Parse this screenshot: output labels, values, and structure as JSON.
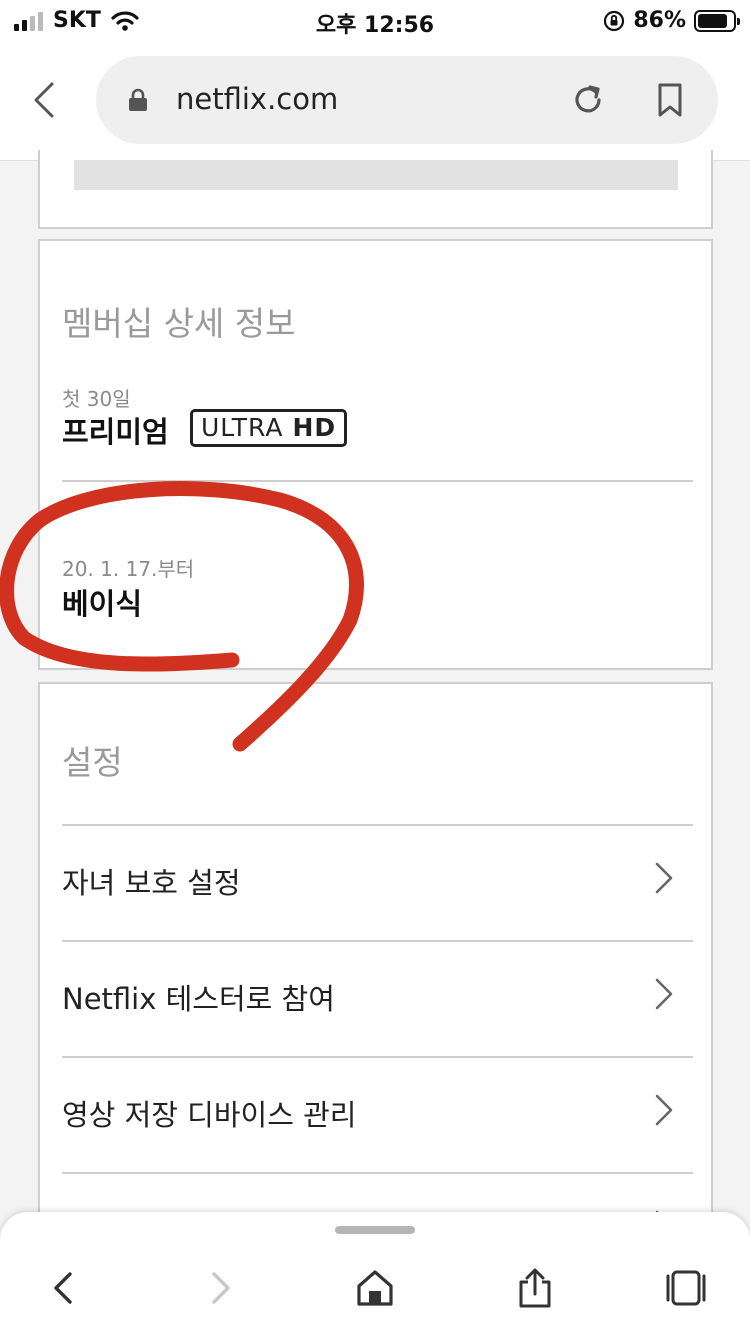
{
  "status_bar": {
    "carrier": "SKT",
    "time": "오후 12:56",
    "battery_percent": "86%",
    "battery_level": 0.86
  },
  "browser": {
    "url": "netflix.com"
  },
  "membership": {
    "title": "멤버십 상세 정보",
    "current_plan": {
      "note": "첫 30일",
      "name": "프리미엄",
      "badge_regular": "ULTRA",
      "badge_bold": "HD"
    },
    "next_plan": {
      "note": "20. 1. 17.부터",
      "name": "베이식"
    }
  },
  "settings": {
    "title": "설정",
    "items": [
      {
        "label": "자녀 보호 설정"
      },
      {
        "label": "Netflix 테스터로 참여"
      },
      {
        "label": "영상 저장 디바이스 관리"
      },
      {
        "label": ""
      }
    ]
  },
  "colors": {
    "annotation_red": "#d0321f",
    "section_title_gray": "#9a9a9a",
    "border_gray": "#cfcfcf"
  },
  "icons": {
    "back": "chevron-left-icon",
    "lock": "lock-icon",
    "reload": "reload-icon",
    "bookmark": "bookmark-icon",
    "forward": "chevron-right-icon",
    "home": "home-icon",
    "share": "share-icon",
    "tabs": "tabs-icon"
  }
}
